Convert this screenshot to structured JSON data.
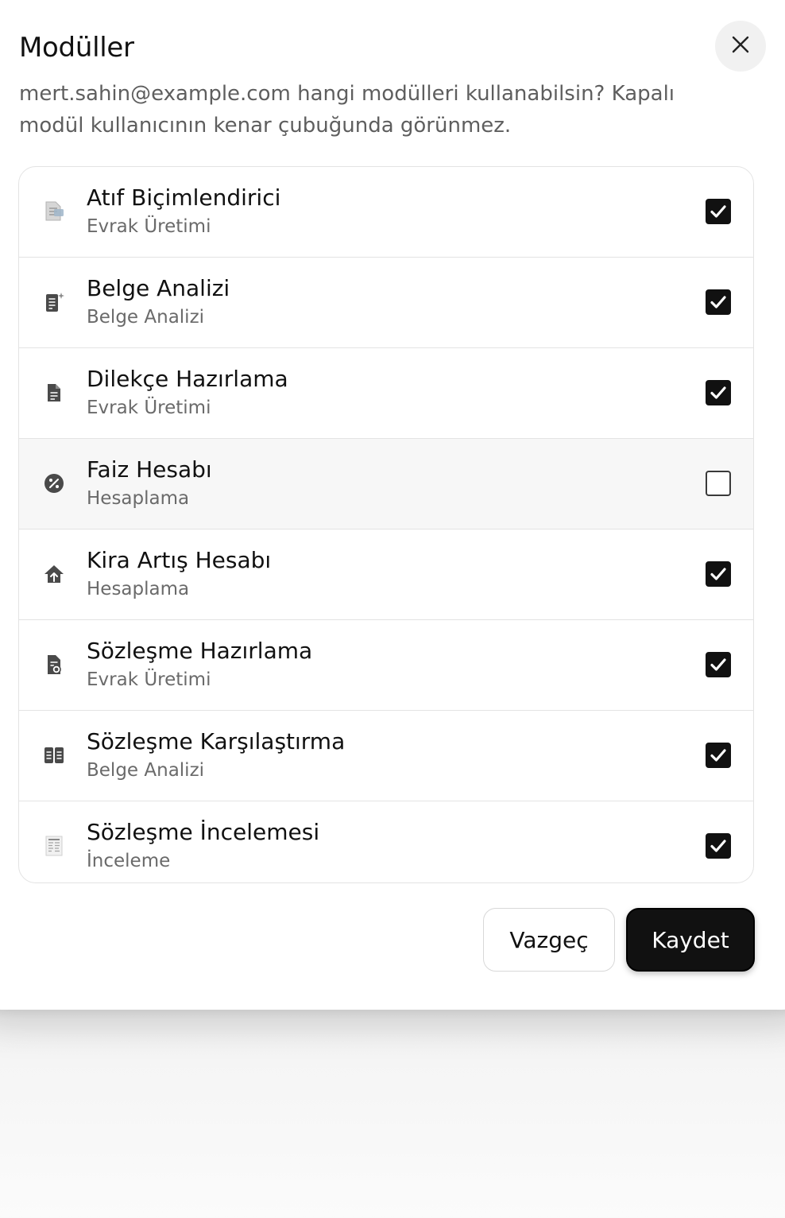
{
  "dialog": {
    "title": "Modüller",
    "description": "mert.sahin@example.com hangi modülleri kullanabilsin? Kapalı modül kullanıcının kenar çubuğunda görünmez.",
    "close_icon": "close-icon"
  },
  "modules": [
    {
      "name": "Atıf Biçimlendirici",
      "category": "Evrak Üretimi",
      "enabled": true,
      "icon": "citation-document-icon"
    },
    {
      "name": "Belge Analizi",
      "category": "Belge Analizi",
      "enabled": true,
      "icon": "document-sparkle-icon"
    },
    {
      "name": "Dilekçe Hazırlama",
      "category": "Evrak Üretimi",
      "enabled": true,
      "icon": "document-icon"
    },
    {
      "name": "Faiz Hesabı",
      "category": "Hesaplama",
      "enabled": false,
      "icon": "percent-icon"
    },
    {
      "name": "Kira Artış Hesabı",
      "category": "Hesaplama",
      "enabled": true,
      "icon": "house-up-icon"
    },
    {
      "name": "Sözleşme Hazırlama",
      "category": "Evrak Üretimi",
      "enabled": true,
      "icon": "contract-icon"
    },
    {
      "name": "Sözleşme Karşılaştırma",
      "category": "Belge Analizi",
      "enabled": true,
      "icon": "compare-documents-icon"
    },
    {
      "name": "Sözleşme İncelemesi",
      "category": "İnceleme",
      "enabled": true,
      "icon": "review-document-icon"
    }
  ],
  "actions": {
    "cancel_label": "Vazgeç",
    "save_label": "Kaydet"
  },
  "colors": {
    "primary": "#111111",
    "muted_text": "#5e5e5e",
    "border": "#e3e3e3",
    "disabled_row_bg": "#f7f7f7"
  }
}
